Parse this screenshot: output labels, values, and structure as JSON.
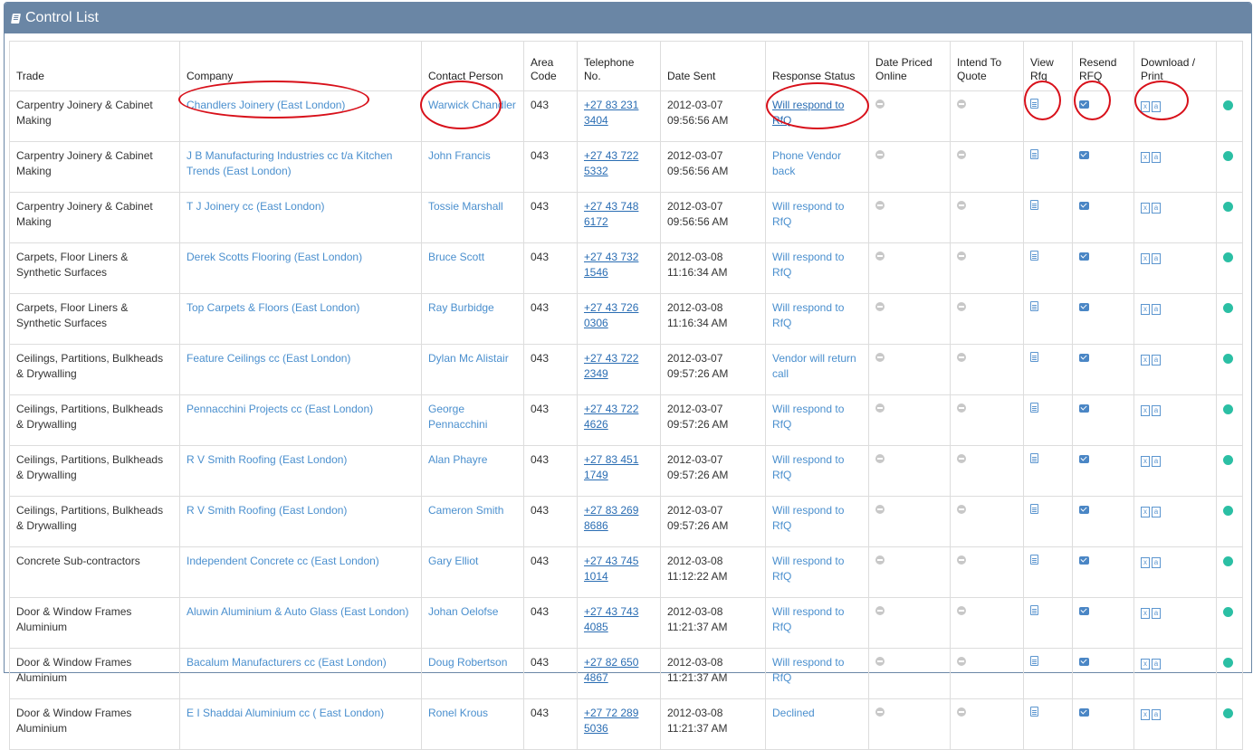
{
  "panel": {
    "title": "Control List"
  },
  "headers": {
    "trade": "Trade",
    "company": "Company",
    "contact": "Contact Person",
    "area": "Area Code",
    "phone": "Telephone No.",
    "date_sent": "Date Sent",
    "status": "Response Status",
    "date_priced": "Date Priced Online",
    "intend": "Intend To Quote",
    "view": "View Rfq",
    "resend": "Resend RFQ",
    "download": "Download / Print"
  },
  "rows": [
    {
      "trade": "Carpentry Joinery & Cabinet Making",
      "company": "Chandlers Joinery (East London)",
      "contact": "Warwick Chandler",
      "area": "043",
      "phone": "+27 83 231 3404",
      "date": "2012-03-07 09:56:56 AM",
      "status": "Will respond to RfQ"
    },
    {
      "trade": "Carpentry Joinery & Cabinet Making",
      "company": "J B Manufacturing Industries cc t/a Kitchen Trends (East London)",
      "contact": "John Francis",
      "area": "043",
      "phone": "+27 43 722 5332",
      "date": "2012-03-07 09:56:56 AM",
      "status": "Phone Vendor back"
    },
    {
      "trade": "Carpentry Joinery & Cabinet Making",
      "company": "T J Joinery cc (East London)",
      "contact": "Tossie Marshall",
      "area": "043",
      "phone": "+27 43 748 6172",
      "date": "2012-03-07 09:56:56 AM",
      "status": "Will respond to RfQ"
    },
    {
      "trade": "Carpets, Floor Liners & Synthetic Surfaces",
      "company": "Derek Scotts Flooring (East London)",
      "contact": "Bruce Scott",
      "area": "043",
      "phone": "+27 43 732 1546",
      "date": "2012-03-08 11:16:34 AM",
      "status": "Will respond to RfQ"
    },
    {
      "trade": "Carpets, Floor Liners & Synthetic Surfaces",
      "company": "Top Carpets & Floors (East London)",
      "contact": "Ray Burbidge",
      "area": "043",
      "phone": "+27 43 726 0306",
      "date": "2012-03-08 11:16:34 AM",
      "status": "Will respond to RfQ"
    },
    {
      "trade": "Ceilings, Partitions, Bulkheads & Drywalling",
      "company": "Feature Ceilings cc (East London)",
      "contact": "Dylan Mc Alistair",
      "area": "043",
      "phone": "+27 43 722 2349",
      "date": "2012-03-07 09:57:26 AM",
      "status": "Vendor will return call"
    },
    {
      "trade": "Ceilings, Partitions, Bulkheads & Drywalling",
      "company": "Pennacchini Projects cc (East London)",
      "contact": "George Pennacchini",
      "area": "043",
      "phone": "+27 43 722 4626",
      "date": "2012-03-07 09:57:26 AM",
      "status": "Will respond to RfQ"
    },
    {
      "trade": "Ceilings, Partitions, Bulkheads & Drywalling",
      "company": "R V Smith Roofing (East London)",
      "contact": "Alan Phayre",
      "area": "043",
      "phone": "+27 83 451 1749",
      "date": "2012-03-07 09:57:26 AM",
      "status": "Will respond to RfQ"
    },
    {
      "trade": "Ceilings, Partitions, Bulkheads & Drywalling",
      "company": "R V Smith Roofing (East London)",
      "contact": "Cameron Smith",
      "area": "043",
      "phone": "+27 83 269 8686",
      "date": "2012-03-07 09:57:26 AM",
      "status": "Will respond to RfQ"
    },
    {
      "trade": "Concrete Sub-contractors",
      "company": "Independent Concrete cc (East London)",
      "contact": "Gary Elliot",
      "area": "043",
      "phone": "+27 43 745 1014",
      "date": "2012-03-08 11:12:22 AM",
      "status": "Will respond to RfQ"
    },
    {
      "trade": "Door & Window Frames Aluminium",
      "company": "Aluwin Aluminium & Auto Glass (East London)",
      "contact": "Johan Oelofse",
      "area": "043",
      "phone": "+27 43 743 4085",
      "date": "2012-03-08 11:21:37 AM",
      "status": "Will respond to RfQ"
    },
    {
      "trade": "Door & Window Frames Aluminium",
      "company": "Bacalum Manufacturers cc (East London)",
      "contact": "Doug Robertson",
      "area": "043",
      "phone": "+27 82 650 4867",
      "date": "2012-03-08 11:21:37 AM",
      "status": "Will respond to RfQ"
    },
    {
      "trade": "Door & Window Frames Aluminium",
      "company": "E I Shaddai Aluminium cc ( East London)",
      "contact": "Ronel Krous",
      "area": "043",
      "phone": "+27 72 289 5036",
      "date": "2012-03-08 11:21:37 AM",
      "status": "Declined"
    }
  ],
  "icons": {
    "not_set": "minus-circle-icon",
    "view": "document-icon",
    "resend": "envelope-icon",
    "excel": "excel-file-icon",
    "pdf": "pdf-file-icon",
    "status_dot": "status-dot-icon"
  },
  "colors": {
    "header_bg": "#6a86a5",
    "link": "#4a8fce",
    "status_dot": "#2bbfa4",
    "annotation": "#d8101a"
  }
}
